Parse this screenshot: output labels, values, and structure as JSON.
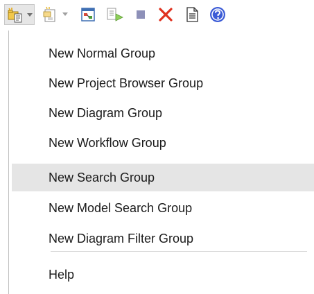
{
  "toolbar": {
    "buttons": [
      {
        "icon": "new-group-icon",
        "dropdown": true,
        "active": true
      },
      {
        "icon": "new-item-icon",
        "dropdown": true,
        "active": false
      },
      {
        "icon": "diagram-icon",
        "dropdown": false,
        "active": false
      },
      {
        "icon": "run-icon",
        "dropdown": false,
        "active": false
      },
      {
        "icon": "stop-icon",
        "dropdown": false,
        "active": false
      },
      {
        "icon": "delete-icon",
        "dropdown": false,
        "active": false
      },
      {
        "icon": "document-icon",
        "dropdown": false,
        "active": false
      },
      {
        "icon": "help-icon",
        "dropdown": false,
        "active": false
      }
    ],
    "colors": {
      "delete": "#e0311f",
      "help": "#3b5bd6",
      "stop": "#8d90b8",
      "dropdown_arrow": "#9a9a9a"
    }
  },
  "menu": {
    "items": [
      {
        "label": "New Normal Group",
        "highlighted": false
      },
      {
        "label": "New Project Browser Group",
        "highlighted": false
      },
      {
        "label": "New Diagram Group",
        "highlighted": false
      },
      {
        "label": "New Workflow Group",
        "highlighted": false
      },
      {
        "label": "New Search Group",
        "highlighted": true
      },
      {
        "label": "New Model Search Group",
        "highlighted": false
      },
      {
        "label": "New Diagram Filter Group",
        "highlighted": false
      }
    ],
    "help_label": "Help",
    "highlight_color": "#e5e5e5"
  }
}
